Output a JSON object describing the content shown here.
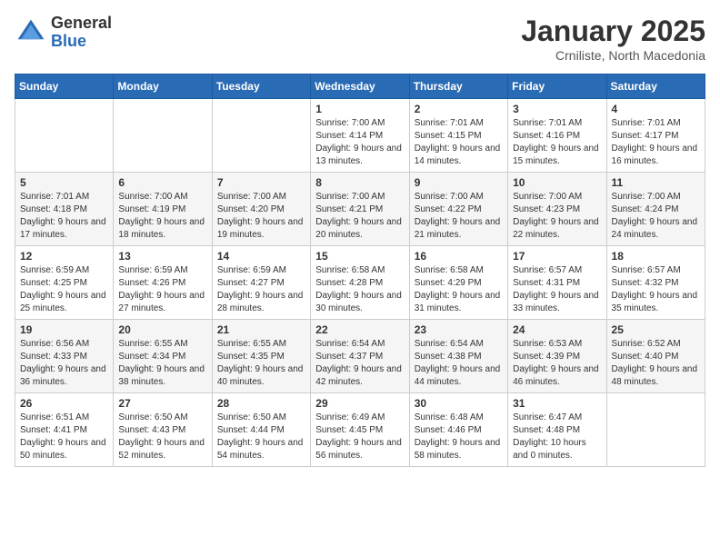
{
  "header": {
    "logo_general": "General",
    "logo_blue": "Blue",
    "month_title": "January 2025",
    "subtitle": "Crniliste, North Macedonia"
  },
  "days_of_week": [
    "Sunday",
    "Monday",
    "Tuesday",
    "Wednesday",
    "Thursday",
    "Friday",
    "Saturday"
  ],
  "weeks": [
    [
      {
        "day": "",
        "sunrise": "",
        "sunset": "",
        "daylight": ""
      },
      {
        "day": "",
        "sunrise": "",
        "sunset": "",
        "daylight": ""
      },
      {
        "day": "",
        "sunrise": "",
        "sunset": "",
        "daylight": ""
      },
      {
        "day": "1",
        "sunrise": "Sunrise: 7:00 AM",
        "sunset": "Sunset: 4:14 PM",
        "daylight": "Daylight: 9 hours and 13 minutes."
      },
      {
        "day": "2",
        "sunrise": "Sunrise: 7:01 AM",
        "sunset": "Sunset: 4:15 PM",
        "daylight": "Daylight: 9 hours and 14 minutes."
      },
      {
        "day": "3",
        "sunrise": "Sunrise: 7:01 AM",
        "sunset": "Sunset: 4:16 PM",
        "daylight": "Daylight: 9 hours and 15 minutes."
      },
      {
        "day": "4",
        "sunrise": "Sunrise: 7:01 AM",
        "sunset": "Sunset: 4:17 PM",
        "daylight": "Daylight: 9 hours and 16 minutes."
      }
    ],
    [
      {
        "day": "5",
        "sunrise": "Sunrise: 7:01 AM",
        "sunset": "Sunset: 4:18 PM",
        "daylight": "Daylight: 9 hours and 17 minutes."
      },
      {
        "day": "6",
        "sunrise": "Sunrise: 7:00 AM",
        "sunset": "Sunset: 4:19 PM",
        "daylight": "Daylight: 9 hours and 18 minutes."
      },
      {
        "day": "7",
        "sunrise": "Sunrise: 7:00 AM",
        "sunset": "Sunset: 4:20 PM",
        "daylight": "Daylight: 9 hours and 19 minutes."
      },
      {
        "day": "8",
        "sunrise": "Sunrise: 7:00 AM",
        "sunset": "Sunset: 4:21 PM",
        "daylight": "Daylight: 9 hours and 20 minutes."
      },
      {
        "day": "9",
        "sunrise": "Sunrise: 7:00 AM",
        "sunset": "Sunset: 4:22 PM",
        "daylight": "Daylight: 9 hours and 21 minutes."
      },
      {
        "day": "10",
        "sunrise": "Sunrise: 7:00 AM",
        "sunset": "Sunset: 4:23 PM",
        "daylight": "Daylight: 9 hours and 22 minutes."
      },
      {
        "day": "11",
        "sunrise": "Sunrise: 7:00 AM",
        "sunset": "Sunset: 4:24 PM",
        "daylight": "Daylight: 9 hours and 24 minutes."
      }
    ],
    [
      {
        "day": "12",
        "sunrise": "Sunrise: 6:59 AM",
        "sunset": "Sunset: 4:25 PM",
        "daylight": "Daylight: 9 hours and 25 minutes."
      },
      {
        "day": "13",
        "sunrise": "Sunrise: 6:59 AM",
        "sunset": "Sunset: 4:26 PM",
        "daylight": "Daylight: 9 hours and 27 minutes."
      },
      {
        "day": "14",
        "sunrise": "Sunrise: 6:59 AM",
        "sunset": "Sunset: 4:27 PM",
        "daylight": "Daylight: 9 hours and 28 minutes."
      },
      {
        "day": "15",
        "sunrise": "Sunrise: 6:58 AM",
        "sunset": "Sunset: 4:28 PM",
        "daylight": "Daylight: 9 hours and 30 minutes."
      },
      {
        "day": "16",
        "sunrise": "Sunrise: 6:58 AM",
        "sunset": "Sunset: 4:29 PM",
        "daylight": "Daylight: 9 hours and 31 minutes."
      },
      {
        "day": "17",
        "sunrise": "Sunrise: 6:57 AM",
        "sunset": "Sunset: 4:31 PM",
        "daylight": "Daylight: 9 hours and 33 minutes."
      },
      {
        "day": "18",
        "sunrise": "Sunrise: 6:57 AM",
        "sunset": "Sunset: 4:32 PM",
        "daylight": "Daylight: 9 hours and 35 minutes."
      }
    ],
    [
      {
        "day": "19",
        "sunrise": "Sunrise: 6:56 AM",
        "sunset": "Sunset: 4:33 PM",
        "daylight": "Daylight: 9 hours and 36 minutes."
      },
      {
        "day": "20",
        "sunrise": "Sunrise: 6:55 AM",
        "sunset": "Sunset: 4:34 PM",
        "daylight": "Daylight: 9 hours and 38 minutes."
      },
      {
        "day": "21",
        "sunrise": "Sunrise: 6:55 AM",
        "sunset": "Sunset: 4:35 PM",
        "daylight": "Daylight: 9 hours and 40 minutes."
      },
      {
        "day": "22",
        "sunrise": "Sunrise: 6:54 AM",
        "sunset": "Sunset: 4:37 PM",
        "daylight": "Daylight: 9 hours and 42 minutes."
      },
      {
        "day": "23",
        "sunrise": "Sunrise: 6:54 AM",
        "sunset": "Sunset: 4:38 PM",
        "daylight": "Daylight: 9 hours and 44 minutes."
      },
      {
        "day": "24",
        "sunrise": "Sunrise: 6:53 AM",
        "sunset": "Sunset: 4:39 PM",
        "daylight": "Daylight: 9 hours and 46 minutes."
      },
      {
        "day": "25",
        "sunrise": "Sunrise: 6:52 AM",
        "sunset": "Sunset: 4:40 PM",
        "daylight": "Daylight: 9 hours and 48 minutes."
      }
    ],
    [
      {
        "day": "26",
        "sunrise": "Sunrise: 6:51 AM",
        "sunset": "Sunset: 4:41 PM",
        "daylight": "Daylight: 9 hours and 50 minutes."
      },
      {
        "day": "27",
        "sunrise": "Sunrise: 6:50 AM",
        "sunset": "Sunset: 4:43 PM",
        "daylight": "Daylight: 9 hours and 52 minutes."
      },
      {
        "day": "28",
        "sunrise": "Sunrise: 6:50 AM",
        "sunset": "Sunset: 4:44 PM",
        "daylight": "Daylight: 9 hours and 54 minutes."
      },
      {
        "day": "29",
        "sunrise": "Sunrise: 6:49 AM",
        "sunset": "Sunset: 4:45 PM",
        "daylight": "Daylight: 9 hours and 56 minutes."
      },
      {
        "day": "30",
        "sunrise": "Sunrise: 6:48 AM",
        "sunset": "Sunset: 4:46 PM",
        "daylight": "Daylight: 9 hours and 58 minutes."
      },
      {
        "day": "31",
        "sunrise": "Sunrise: 6:47 AM",
        "sunset": "Sunset: 4:48 PM",
        "daylight": "Daylight: 10 hours and 0 minutes."
      },
      {
        "day": "",
        "sunrise": "",
        "sunset": "",
        "daylight": ""
      }
    ]
  ]
}
